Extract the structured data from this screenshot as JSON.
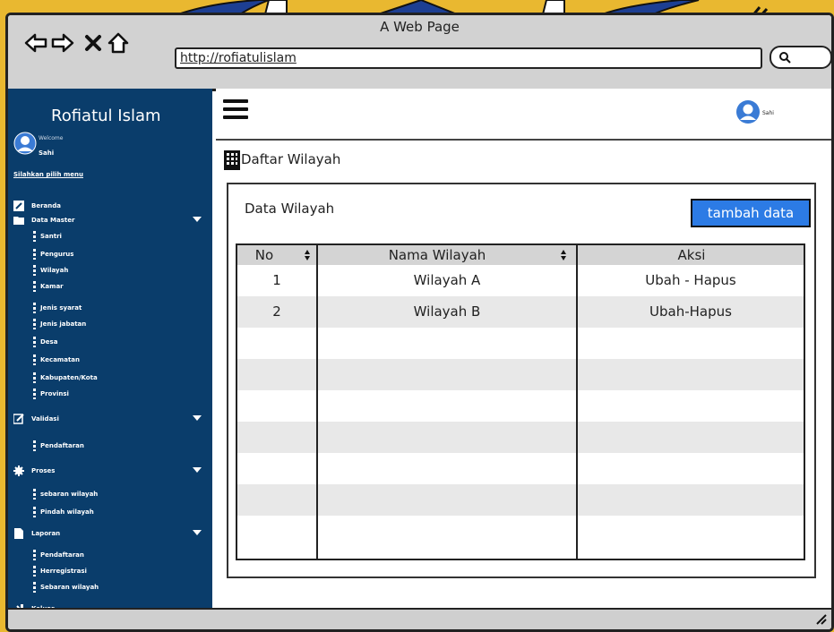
{
  "window": {
    "title": "A Web Page"
  },
  "browser": {
    "url": "http://rofiatulislam"
  },
  "sidebar": {
    "brand": "Rofiatul Islam",
    "welcome": "Welcome",
    "user": "Sahi",
    "hint": "Silahkan pilih menu",
    "items": [
      {
        "label": "Beranda",
        "icon": "pencil-icon"
      },
      {
        "label": "Data Master",
        "icon": "folder-icon",
        "expandable": true
      },
      {
        "label": "Santri",
        "sub": true
      },
      {
        "label": "Pengurus",
        "sub": true
      },
      {
        "label": "Wilayah",
        "sub": true
      },
      {
        "label": "Kamar",
        "sub": true
      },
      {
        "label": "Jenis syarat",
        "sub": true
      },
      {
        "label": "Jenis jabatan",
        "sub": true
      },
      {
        "label": "Desa",
        "sub": true
      },
      {
        "label": "Kecamatan",
        "sub": true
      },
      {
        "label": "Kabupaten/Kota",
        "sub": true
      },
      {
        "label": "Provinsi",
        "sub": true
      },
      {
        "label": "Validasi",
        "icon": "edit-icon",
        "expandable": true
      },
      {
        "label": "Pendaftaran",
        "sub": true
      },
      {
        "label": "Proses",
        "icon": "gear-icon",
        "expandable": true
      },
      {
        "label": "sebaran wilayah",
        "sub": true
      },
      {
        "label": "Pindah wilayah",
        "sub": true
      },
      {
        "label": "Laporan",
        "icon": "document-icon",
        "expandable": true
      },
      {
        "label": "Pendaftaran",
        "sub": true
      },
      {
        "label": "Herregistrasi",
        "sub": true
      },
      {
        "label": "Sebaran wilayah",
        "sub": true
      },
      {
        "label": "Keluar",
        "icon": "logout-icon"
      }
    ]
  },
  "topbar": {
    "user": "Sahi"
  },
  "page": {
    "title": "Daftar Wilayah"
  },
  "card": {
    "title": "Data Wilayah",
    "add_label": "tambah data"
  },
  "table": {
    "columns": [
      "No",
      "Nama Wilayah",
      "Aksi"
    ],
    "rows": [
      [
        "1",
        "Wilayah A",
        "Ubah - Hapus"
      ],
      [
        "2",
        "Wilayah B",
        "Ubah-Hapus"
      ]
    ]
  },
  "colors": {
    "sidebar": "#0a3d6b",
    "accent": "#2c7be5",
    "background": "#e9b830"
  }
}
